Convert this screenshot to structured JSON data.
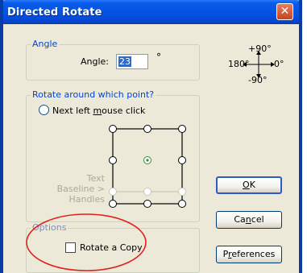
{
  "window": {
    "title": "Directed Rotate",
    "close_glyph": "✕"
  },
  "angle_group": {
    "legend": "Angle",
    "label": "Angle:",
    "value": "23",
    "unit": "°"
  },
  "compass": {
    "top": "+90°",
    "left": "180°",
    "right": "0°",
    "bottom": "-90°"
  },
  "rotate_group": {
    "legend": "Rotate around which point?",
    "radio_prefix": "Next left ",
    "radio_access_key": "m",
    "radio_suffix": "ouse click",
    "handles_label": [
      "Text",
      "Baseline >",
      "Handles"
    ]
  },
  "options_group": {
    "legend": "Options",
    "checkbox_label": "Rotate a Copy",
    "checkbox_checked": false
  },
  "buttons": {
    "ok_key": "O",
    "ok_rest": "K",
    "cancel_pre": "Ca",
    "cancel_key": "n",
    "cancel_post": "cel",
    "prefs_pre": "P",
    "prefs_key": "r",
    "prefs_post": "eferences"
  },
  "annotation": {
    "color": "#e0201c"
  }
}
